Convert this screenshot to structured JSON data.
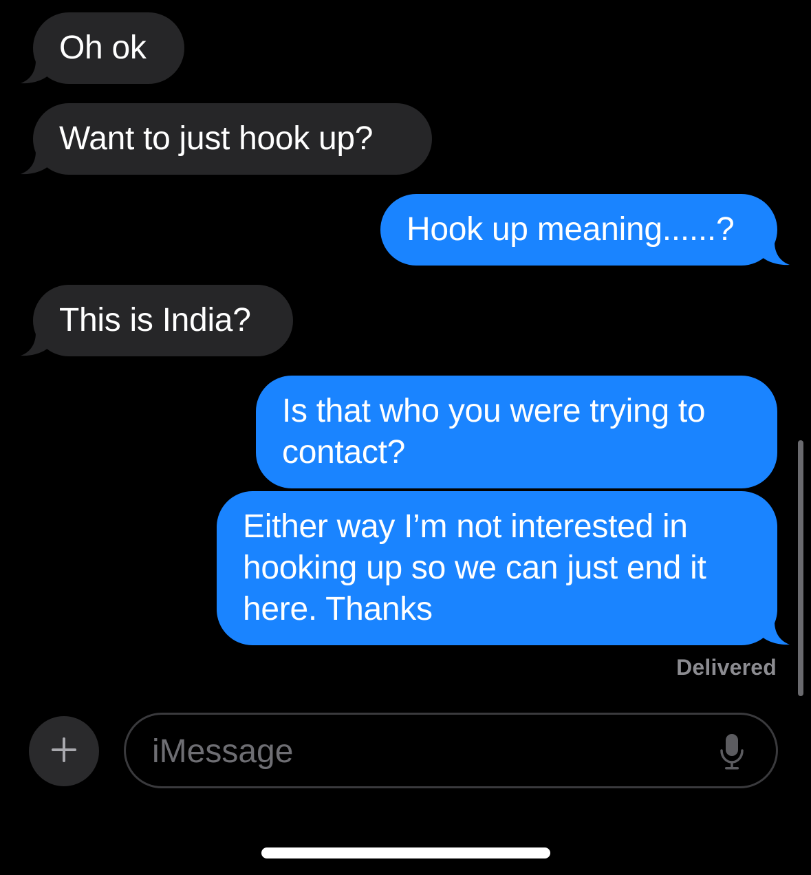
{
  "conversation": {
    "messages": [
      {
        "direction": "received",
        "text": "Oh ok"
      },
      {
        "direction": "received",
        "text": "Want to just hook up?"
      },
      {
        "direction": "sent",
        "text": "Hook up meaning......?"
      },
      {
        "direction": "received",
        "text": "This is India?"
      },
      {
        "direction": "sent",
        "text": "Is that who you were trying to contact?"
      },
      {
        "direction": "sent",
        "text": "Either way I’m not interested in hooking up so we can just end it here. Thanks"
      }
    ],
    "status": "Delivered"
  },
  "composer": {
    "placeholder": "iMessage",
    "add_icon": "plus-icon",
    "dictation_icon": "microphone-icon"
  },
  "colors": {
    "background": "#000000",
    "received_bubble": "#262628",
    "sent_bubble": "#1a84ff",
    "status_text": "#8c8c91"
  }
}
